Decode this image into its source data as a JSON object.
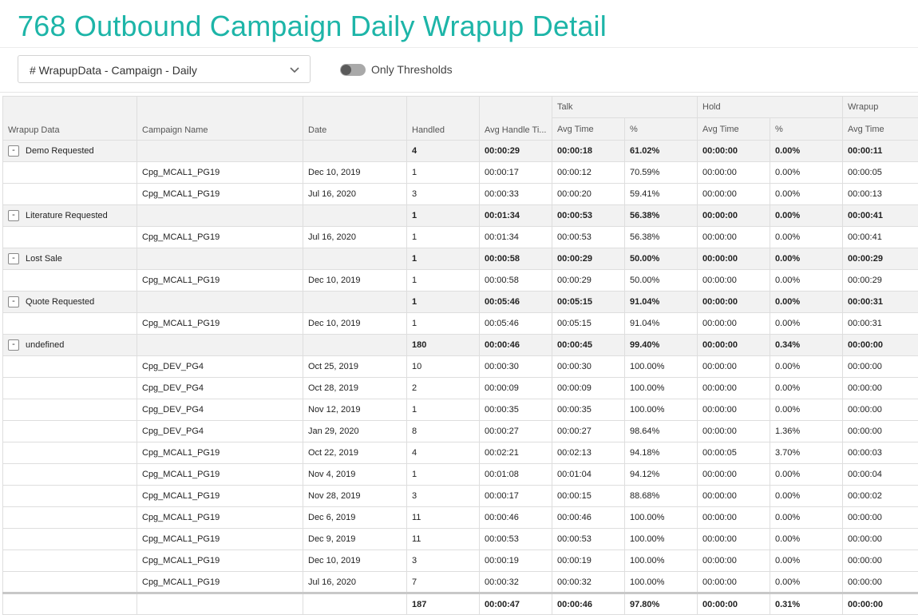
{
  "page": {
    "title": "768 Outbound Campaign Daily Wrapup Detail"
  },
  "controls": {
    "selector_value": "# WrapupData - Campaign - Daily",
    "toggle_label": "Only Thresholds",
    "toggle_on": false
  },
  "table": {
    "group_headers": {
      "talk": "Talk",
      "hold": "Hold",
      "wrapup": "Wrapup"
    },
    "columns": {
      "wrapup_data": "Wrapup Data",
      "campaign_name": "Campaign Name",
      "date": "Date",
      "handled": "Handled",
      "avg_handle_time": "Avg Handle Ti...",
      "talk_avg_time": "Avg Time",
      "talk_pct": "%",
      "hold_avg_time": "Avg Time",
      "hold_pct": "%",
      "wrapup_avg_time": "Avg Time"
    },
    "rows": [
      {
        "type": "group",
        "expand": "-",
        "wrapup": "Demo Requested",
        "campaign": "",
        "date": "",
        "handled": "4",
        "aht": "00:00:29",
        "talk_time": "00:00:18",
        "talk_pct": "61.02%",
        "hold_time": "00:00:00",
        "hold_pct": "0.00%",
        "wrap_time": "00:00:11"
      },
      {
        "type": "detail",
        "wrapup": "",
        "campaign": "Cpg_MCAL1_PG19",
        "date": "Dec 10, 2019",
        "handled": "1",
        "aht": "00:00:17",
        "talk_time": "00:00:12",
        "talk_pct": "70.59%",
        "hold_time": "00:00:00",
        "hold_pct": "0.00%",
        "wrap_time": "00:00:05"
      },
      {
        "type": "detail",
        "wrapup": "",
        "campaign": "Cpg_MCAL1_PG19",
        "date": "Jul 16, 2020",
        "handled": "3",
        "aht": "00:00:33",
        "talk_time": "00:00:20",
        "talk_pct": "59.41%",
        "hold_time": "00:00:00",
        "hold_pct": "0.00%",
        "wrap_time": "00:00:13"
      },
      {
        "type": "group",
        "expand": "-",
        "wrapup": "Literature Requested",
        "campaign": "",
        "date": "",
        "handled": "1",
        "aht": "00:01:34",
        "talk_time": "00:00:53",
        "talk_pct": "56.38%",
        "hold_time": "00:00:00",
        "hold_pct": "0.00%",
        "wrap_time": "00:00:41"
      },
      {
        "type": "detail",
        "wrapup": "",
        "campaign": "Cpg_MCAL1_PG19",
        "date": "Jul 16, 2020",
        "handled": "1",
        "aht": "00:01:34",
        "talk_time": "00:00:53",
        "talk_pct": "56.38%",
        "hold_time": "00:00:00",
        "hold_pct": "0.00%",
        "wrap_time": "00:00:41"
      },
      {
        "type": "group",
        "expand": "-",
        "wrapup": "Lost Sale",
        "campaign": "",
        "date": "",
        "handled": "1",
        "aht": "00:00:58",
        "talk_time": "00:00:29",
        "talk_pct": "50.00%",
        "hold_time": "00:00:00",
        "hold_pct": "0.00%",
        "wrap_time": "00:00:29"
      },
      {
        "type": "detail",
        "wrapup": "",
        "campaign": "Cpg_MCAL1_PG19",
        "date": "Dec 10, 2019",
        "handled": "1",
        "aht": "00:00:58",
        "talk_time": "00:00:29",
        "talk_pct": "50.00%",
        "hold_time": "00:00:00",
        "hold_pct": "0.00%",
        "wrap_time": "00:00:29"
      },
      {
        "type": "group",
        "expand": "-",
        "wrapup": "Quote Requested",
        "campaign": "",
        "date": "",
        "handled": "1",
        "aht": "00:05:46",
        "talk_time": "00:05:15",
        "talk_pct": "91.04%",
        "hold_time": "00:00:00",
        "hold_pct": "0.00%",
        "wrap_time": "00:00:31"
      },
      {
        "type": "detail",
        "wrapup": "",
        "campaign": "Cpg_MCAL1_PG19",
        "date": "Dec 10, 2019",
        "handled": "1",
        "aht": "00:05:46",
        "talk_time": "00:05:15",
        "talk_pct": "91.04%",
        "hold_time": "00:00:00",
        "hold_pct": "0.00%",
        "wrap_time": "00:00:31"
      },
      {
        "type": "group",
        "expand": "-",
        "wrapup": "undefined",
        "campaign": "",
        "date": "",
        "handled": "180",
        "aht": "00:00:46",
        "talk_time": "00:00:45",
        "talk_pct": "99.40%",
        "hold_time": "00:00:00",
        "hold_pct": "0.34%",
        "wrap_time": "00:00:00"
      },
      {
        "type": "detail",
        "wrapup": "",
        "campaign": "Cpg_DEV_PG4",
        "date": "Oct 25, 2019",
        "handled": "10",
        "aht": "00:00:30",
        "talk_time": "00:00:30",
        "talk_pct": "100.00%",
        "hold_time": "00:00:00",
        "hold_pct": "0.00%",
        "wrap_time": "00:00:00"
      },
      {
        "type": "detail",
        "wrapup": "",
        "campaign": "Cpg_DEV_PG4",
        "date": "Oct 28, 2019",
        "handled": "2",
        "aht": "00:00:09",
        "talk_time": "00:00:09",
        "talk_pct": "100.00%",
        "hold_time": "00:00:00",
        "hold_pct": "0.00%",
        "wrap_time": "00:00:00"
      },
      {
        "type": "detail",
        "wrapup": "",
        "campaign": "Cpg_DEV_PG4",
        "date": "Nov 12, 2019",
        "handled": "1",
        "aht": "00:00:35",
        "talk_time": "00:00:35",
        "talk_pct": "100.00%",
        "hold_time": "00:00:00",
        "hold_pct": "0.00%",
        "wrap_time": "00:00:00"
      },
      {
        "type": "detail",
        "wrapup": "",
        "campaign": "Cpg_DEV_PG4",
        "date": "Jan 29, 2020",
        "handled": "8",
        "aht": "00:00:27",
        "talk_time": "00:00:27",
        "talk_pct": "98.64%",
        "hold_time": "00:00:00",
        "hold_pct": "1.36%",
        "wrap_time": "00:00:00"
      },
      {
        "type": "detail",
        "wrapup": "",
        "campaign": "Cpg_MCAL1_PG19",
        "date": "Oct 22, 2019",
        "handled": "4",
        "aht": "00:02:21",
        "talk_time": "00:02:13",
        "talk_pct": "94.18%",
        "hold_time": "00:00:05",
        "hold_pct": "3.70%",
        "wrap_time": "00:00:03"
      },
      {
        "type": "detail",
        "wrapup": "",
        "campaign": "Cpg_MCAL1_PG19",
        "date": "Nov 4, 2019",
        "handled": "1",
        "aht": "00:01:08",
        "talk_time": "00:01:04",
        "talk_pct": "94.12%",
        "hold_time": "00:00:00",
        "hold_pct": "0.00%",
        "wrap_time": "00:00:04"
      },
      {
        "type": "detail",
        "wrapup": "",
        "campaign": "Cpg_MCAL1_PG19",
        "date": "Nov 28, 2019",
        "handled": "3",
        "aht": "00:00:17",
        "talk_time": "00:00:15",
        "talk_pct": "88.68%",
        "hold_time": "00:00:00",
        "hold_pct": "0.00%",
        "wrap_time": "00:00:02"
      },
      {
        "type": "detail",
        "wrapup": "",
        "campaign": "Cpg_MCAL1_PG19",
        "date": "Dec 6, 2019",
        "handled": "11",
        "aht": "00:00:46",
        "talk_time": "00:00:46",
        "talk_pct": "100.00%",
        "hold_time": "00:00:00",
        "hold_pct": "0.00%",
        "wrap_time": "00:00:00"
      },
      {
        "type": "detail",
        "wrapup": "",
        "campaign": "Cpg_MCAL1_PG19",
        "date": "Dec 9, 2019",
        "handled": "11",
        "aht": "00:00:53",
        "talk_time": "00:00:53",
        "talk_pct": "100.00%",
        "hold_time": "00:00:00",
        "hold_pct": "0.00%",
        "wrap_time": "00:00:00"
      },
      {
        "type": "detail",
        "wrapup": "",
        "campaign": "Cpg_MCAL1_PG19",
        "date": "Dec 10, 2019",
        "handled": "3",
        "aht": "00:00:19",
        "talk_time": "00:00:19",
        "talk_pct": "100.00%",
        "hold_time": "00:00:00",
        "hold_pct": "0.00%",
        "wrap_time": "00:00:00"
      },
      {
        "type": "detail",
        "wrapup": "",
        "campaign": "Cpg_MCAL1_PG19",
        "date": "Jul 16, 2020",
        "handled": "7",
        "aht": "00:00:32",
        "talk_time": "00:00:32",
        "talk_pct": "100.00%",
        "hold_time": "00:00:00",
        "hold_pct": "0.00%",
        "wrap_time": "00:00:00"
      }
    ],
    "totals": {
      "handled": "187",
      "aht": "00:00:47",
      "talk_time": "00:00:46",
      "talk_pct": "97.80%",
      "hold_time": "00:00:00",
      "hold_pct": "0.31%",
      "wrap_time": "00:00:00"
    }
  },
  "colors": {
    "title": "#1db5a8",
    "header_bg": "#f2f2f2",
    "group_row_bg": "#f2f2f2",
    "toggle_track": "#a9a9a9"
  }
}
